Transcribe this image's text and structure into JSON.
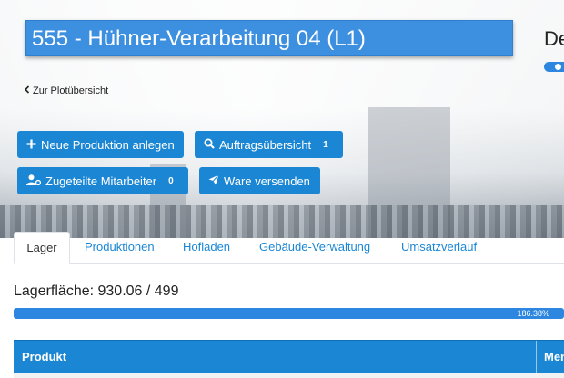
{
  "header": {
    "title": "555 - Hühner-Verarbeitung 04 (L1)",
    "right_label": "De",
    "back_link": "Zur Plotübersicht"
  },
  "actions": {
    "new_production": "Neue Produktion anlegen",
    "order_overview": "Auftragsübersicht",
    "order_overview_count": "1",
    "assigned_staff": "Zugeteilte Mitarbeiter",
    "assigned_staff_count": "0",
    "ship_goods": "Ware versenden"
  },
  "tabs": [
    {
      "label": "Lager",
      "active": true
    },
    {
      "label": "Produktionen",
      "active": false
    },
    {
      "label": "Hofladen",
      "active": false
    },
    {
      "label": "Gebäude-Verwaltung",
      "active": false
    },
    {
      "label": "Umsatzverlauf",
      "active": false
    }
  ],
  "storage": {
    "label": "Lagerfläche: 930.06 / 499",
    "percent_text": "186.38%",
    "fill_fraction": 1.0
  },
  "table": {
    "columns": [
      "Produkt",
      "Men"
    ]
  },
  "icons": {
    "back": "chevron-left-icon",
    "new_production": "plus-icon",
    "order_overview": "search-icon",
    "assigned_staff": "user-cog-icon",
    "ship_goods": "paper-plane-icon"
  },
  "colors": {
    "primary": "#1b86d3",
    "title_bg": "#3d8fe0"
  }
}
